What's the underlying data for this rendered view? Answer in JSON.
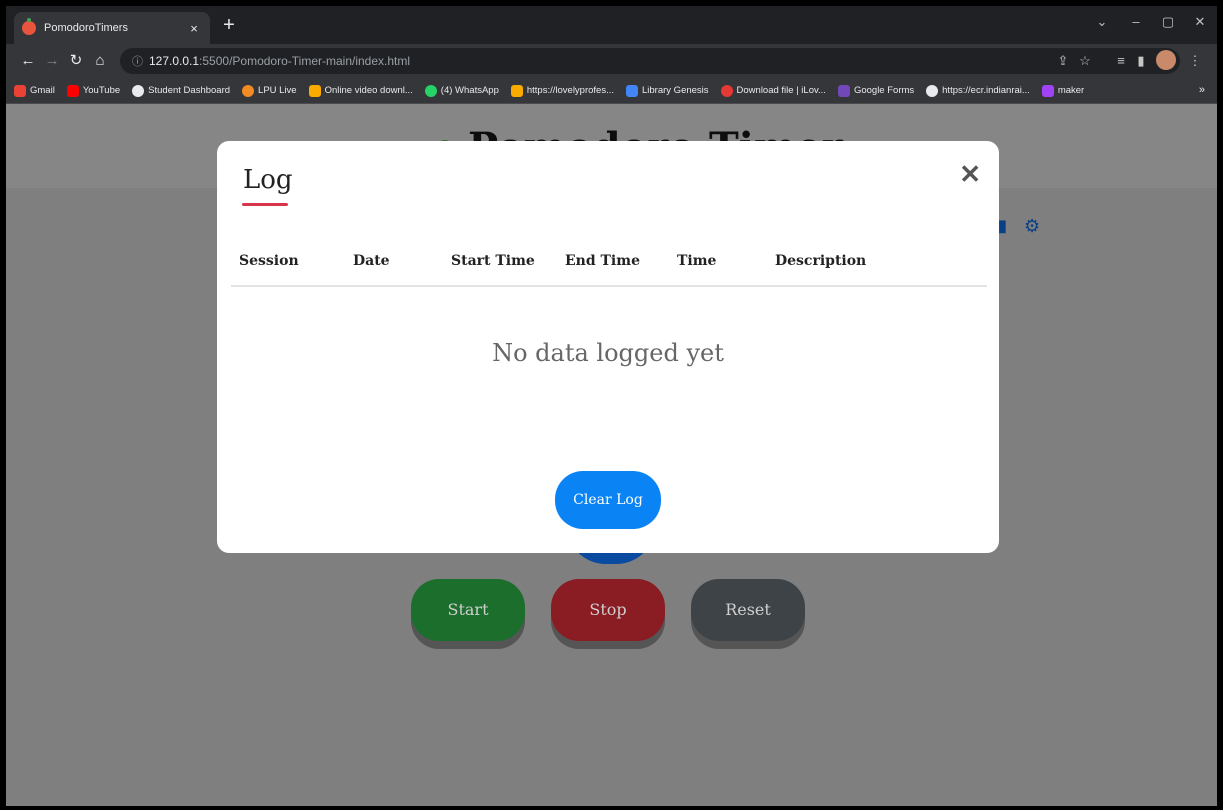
{
  "browser": {
    "tab_title": "PomodoroTimers",
    "tab_close": "×",
    "new_tab": "+",
    "url_host": "127.0.0.1",
    "url_path": ":5500/Pomodoro-Timer-main/index.html",
    "bookmarks": [
      {
        "label": "Gmail",
        "color": "#ea4335"
      },
      {
        "label": "YouTube",
        "color": "#ff0000"
      },
      {
        "label": "Student Dashboard",
        "color": "#e8eaed"
      },
      {
        "label": "LPU Live",
        "color": "#f28b24"
      },
      {
        "label": "Online video downl...",
        "color": "#f9ab00"
      },
      {
        "label": "(4) WhatsApp",
        "color": "#25d366"
      },
      {
        "label": "https://lovelyprofes...",
        "color": "#f9ab00"
      },
      {
        "label": "Library Genesis",
        "color": "#4285f4"
      },
      {
        "label": "Download file | iLov...",
        "color": "#e53935"
      },
      {
        "label": "Google Forms",
        "color": "#7248b9"
      },
      {
        "label": "https://ecr.indianrai...",
        "color": "#e8eaed"
      },
      {
        "label": "maker",
        "color": "#a142f4"
      }
    ],
    "bookmarks_more": "»"
  },
  "page": {
    "title": "Pomodoro Timer",
    "buttons": {
      "start": "Start",
      "stop": "Stop",
      "reset": "Reset"
    }
  },
  "modal": {
    "title": "Log",
    "close_symbol": "✕",
    "columns": [
      "Session",
      "Date",
      "Start Time",
      "End Time",
      "Time",
      "Description"
    ],
    "empty_message": "No data logged yet",
    "clear_button": "Clear Log"
  }
}
